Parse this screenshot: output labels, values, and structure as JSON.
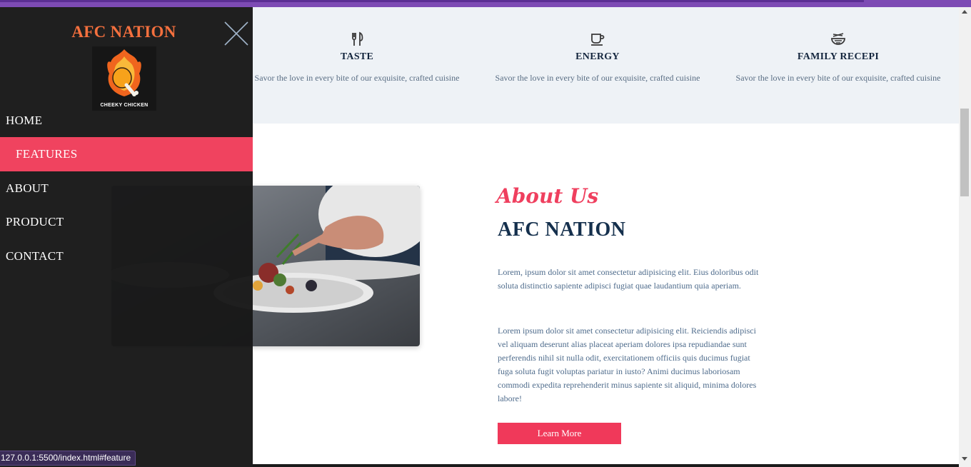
{
  "features": [
    {
      "icon": "utensils-icon",
      "title": "TASTE",
      "desc": "Savor the love in every bite of our exquisite, crafted cuisine"
    },
    {
      "icon": "coffee-cup-icon",
      "title": "ENERGY",
      "desc": "Savor the love in every bite of our exquisite, crafted cuisine"
    },
    {
      "icon": "noodle-bowl-icon",
      "title": "FAMILY RECEPI",
      "desc": "Savor the love in every bite of our exquisite, crafted cuisine"
    }
  ],
  "about": {
    "tagline": "About Us",
    "title": "AFC NATION",
    "paragraph1": "Lorem, ipsum dolor sit amet consectetur adipisicing elit. Eius doloribus odit soluta distinctio sapiente adipisci fugiat quae laudantium quia aperiam.",
    "paragraph2": "Lorem ipsum dolor sit amet consectetur adipisicing elit. Reiciendis adipisci vel aliquam deserunt alias placeat aperiam dolores ipsa repudiandae sunt perferendis nihil sit nulla odit, exercitationem officiis quis ducimus fugiat fuga soluta fugit voluptas pariatur in iusto? Animi ducimus laboriosam commodi expedita reprehenderit minus sapiente sit aliquid, minima dolores labore!",
    "button_label": "Learn More"
  },
  "menu": {
    "brand": "AFC NATION",
    "logo_caption": "CHEEKY CHICKEN",
    "items": [
      {
        "label": "HOME",
        "active": false
      },
      {
        "label": "FEATURES",
        "active": true
      },
      {
        "label": "ABOUT",
        "active": false
      },
      {
        "label": "PRODUCT",
        "active": false
      },
      {
        "label": "CONTACT",
        "active": false
      }
    ]
  },
  "status_bar": {
    "url": "127.0.0.1:5500/index.html#feature"
  },
  "colors": {
    "accent": "#f0435f",
    "brand": "#f4703e",
    "heading": "#15304d",
    "overlay": "#181818",
    "band": "#eef2f6"
  }
}
